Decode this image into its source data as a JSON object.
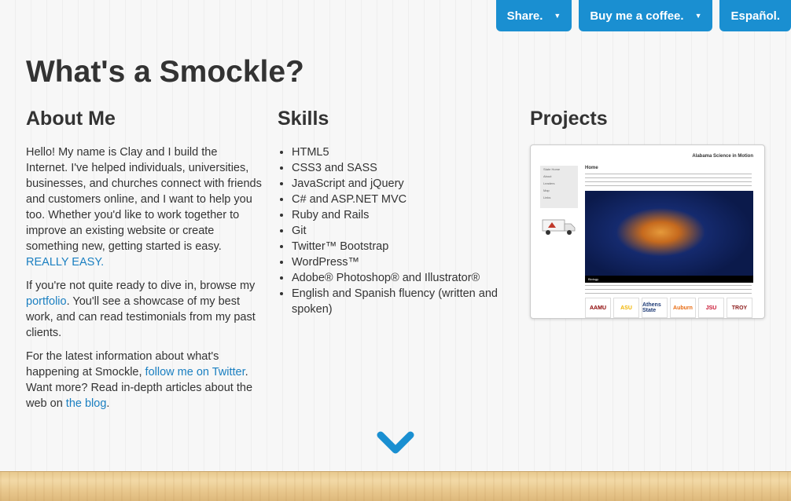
{
  "nav": {
    "share": "Share.",
    "coffee": "Buy me a coffee.",
    "espanol": "Español."
  },
  "title": "What's a Smockle?",
  "about": {
    "heading": "About Me",
    "p1_text": "Hello! My name is Clay and I build the Internet. I've helped individuals, universities, businesses, and churches connect with friends and customers online, and I want to help you too. Whether you'd like to work together to improve an existing website or create something new, getting started is easy.",
    "p1_link": "REALLY EASY.",
    "p2_pre": "If you're not quite ready to dive in, browse my",
    "p2_link": "portfolio",
    "p2_post": ". You'll see a showcase of my best work, and can read testimonials from my past clients.",
    "p3_pre": "For the latest information about what's happening at Smockle,",
    "p3_link1": "follow me on Twitter",
    "p3_mid": ". Want more? Read in-depth articles about the web on",
    "p3_link2": "the blog",
    "p3_post": "."
  },
  "skills": {
    "heading": "Skills",
    "items": [
      "HTML5",
      "CSS3 and SASS",
      "JavaScript and jQuery",
      "C# and ASP.NET MVC",
      "Ruby and Rails",
      "Git",
      "Twitter™ Bootstrap",
      "WordPress™",
      "Adobe® Photoshop® and Illustrator®",
      "English and Spanish fluency (written and spoken)"
    ]
  },
  "projects": {
    "heading": "Projects",
    "shot_title": "Alabama Science in Motion",
    "shot_home": "Home",
    "shot_nav": [
      "State Home",
      "About",
      "Leaders",
      "Map",
      "Links"
    ],
    "shot_caption": "Biology",
    "shot_logos": [
      "AAMU",
      "ASU",
      "Athens State",
      "Auburn",
      "JSU",
      "TROY"
    ]
  },
  "colors": {
    "accent": "#1a8fd1",
    "link": "#1a7fc1"
  },
  "icons": {
    "scroll": "chevron-down-icon",
    "caret": "caret-down-icon"
  }
}
